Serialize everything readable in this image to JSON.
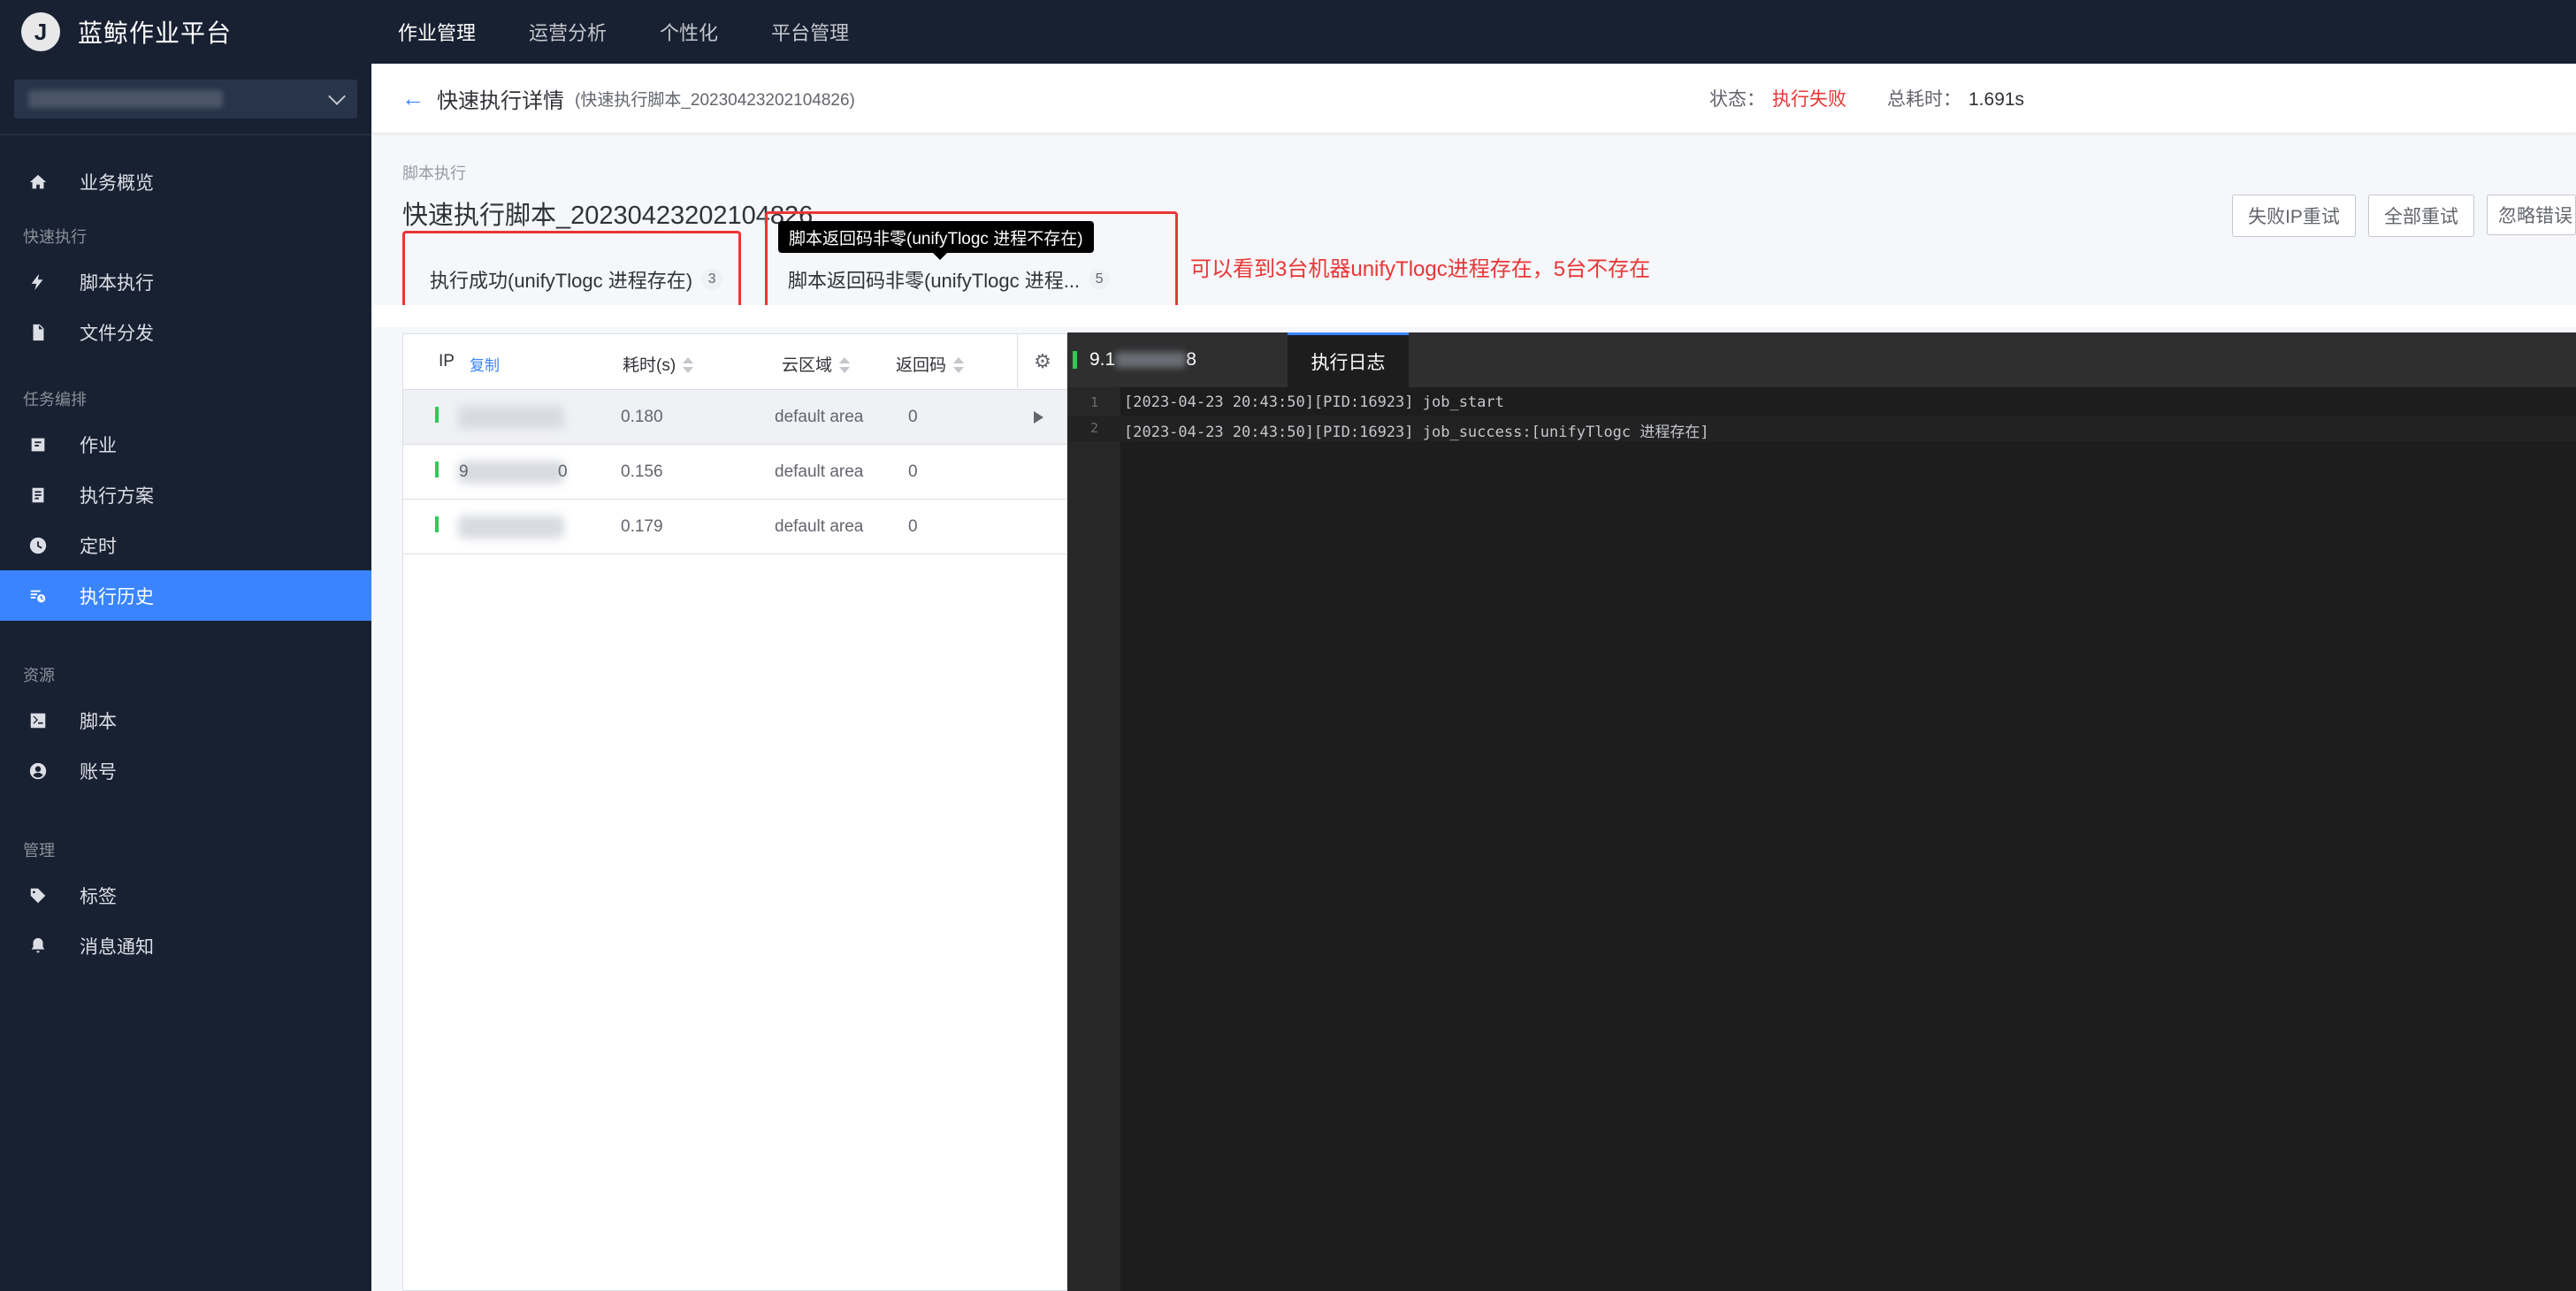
{
  "topbar": {
    "logo_letter": "J",
    "brand": "蓝鲸作业平台",
    "nav": [
      "作业管理",
      "运营分析",
      "个性化",
      "平台管理"
    ]
  },
  "sidebar": {
    "groups": [
      {
        "title": "",
        "items": [
          {
            "label": "业务概览",
            "icon": "home-icon"
          }
        ]
      },
      {
        "title": "快速执行",
        "items": [
          {
            "label": "脚本执行",
            "icon": "bolt-icon"
          },
          {
            "label": "文件分发",
            "icon": "file-icon"
          }
        ]
      },
      {
        "title": "任务编排",
        "items": [
          {
            "label": "作业",
            "icon": "job-icon"
          },
          {
            "label": "执行方案",
            "icon": "plan-icon"
          },
          {
            "label": "定时",
            "icon": "clock-icon"
          },
          {
            "label": "执行历史",
            "icon": "history-icon",
            "active": true
          }
        ]
      },
      {
        "title": "资源",
        "items": [
          {
            "label": "脚本",
            "icon": "terminal-icon"
          },
          {
            "label": "账号",
            "icon": "account-icon"
          }
        ]
      },
      {
        "title": "管理",
        "items": [
          {
            "label": "标签",
            "icon": "tag-icon"
          },
          {
            "label": "消息通知",
            "icon": "bell-icon"
          }
        ]
      }
    ]
  },
  "header": {
    "title": "快速执行详情",
    "subtitle": "(快速执行脚本_20230423202104826)",
    "status_label": "状态：",
    "status_value": "执行失败",
    "duration_label": "总耗时：",
    "duration_value": "1.691s",
    "status_color": "#ea3636"
  },
  "step": {
    "label": "脚本执行",
    "task_name": "快速执行脚本_20230423202104826",
    "buttons": [
      "失败IP重试",
      "全部重试",
      "忽略错误"
    ],
    "groups": [
      {
        "label": "执行成功(unifyTlogc 进程存在)",
        "count": "3"
      },
      {
        "label": "脚本返回码非零(unifyTlogc 进程...",
        "count": "5"
      }
    ],
    "tooltip": "脚本返回码非零(unifyTlogc 进程不存在)",
    "annotation": "可以看到3台机器unifyTlogc进程存在，5台不存在"
  },
  "ip_table": {
    "headers": {
      "ip": "IP",
      "copy": "复制",
      "time": "耗时(s)",
      "cloud": "云区域",
      "code": "返回码"
    },
    "rows": [
      {
        "ip_prefix": "",
        "ip_suffix": "",
        "time": "0.180",
        "cloud": "default area",
        "code": "0"
      },
      {
        "ip_prefix": "9",
        "ip_suffix": "0",
        "time": "0.156",
        "cloud": "default area",
        "code": "0"
      },
      {
        "ip_prefix": "",
        "ip_suffix": "",
        "time": "0.179",
        "cloud": "default area",
        "code": "0"
      }
    ]
  },
  "log": {
    "host_prefix": "9.1",
    "host_suffix": "8",
    "tab": "执行日志",
    "lines": [
      {
        "n": "1",
        "text": "[2023-04-23 20:43:50][PID:16923] job_start"
      },
      {
        "n": "2",
        "text": "[2023-04-23 20:43:50][PID:16923] job_success:[unifyTlogc 进程存在]"
      }
    ]
  }
}
